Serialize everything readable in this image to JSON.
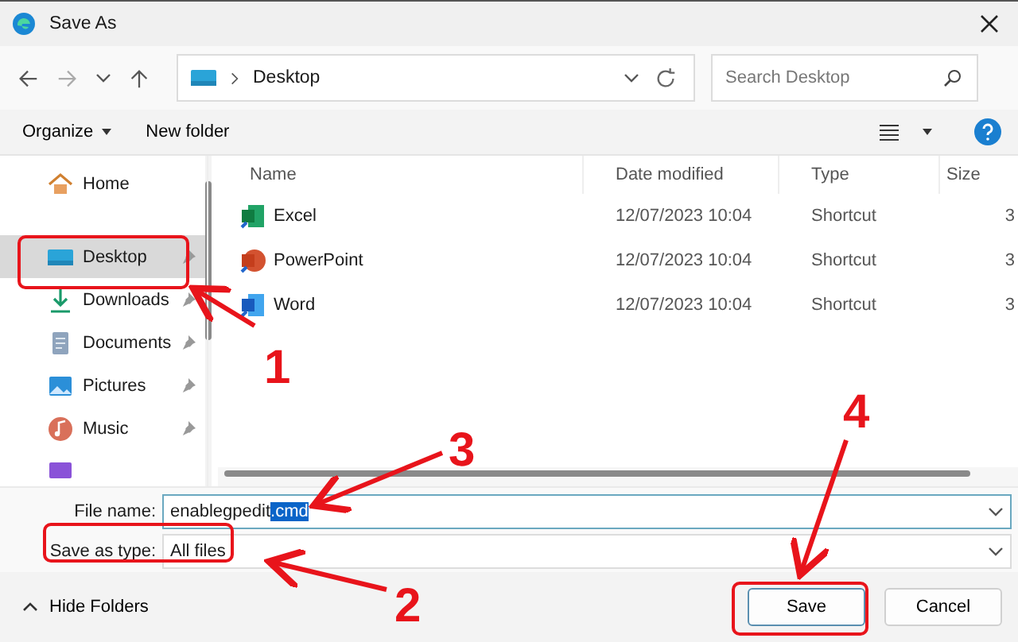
{
  "window": {
    "title": "Save As"
  },
  "address": {
    "location": "Desktop"
  },
  "search": {
    "placeholder": "Search Desktop"
  },
  "toolbar": {
    "organize": "Organize",
    "new_folder": "New folder"
  },
  "sidebar": {
    "items": [
      {
        "label": "Home",
        "kind": "home",
        "selected": false,
        "pinned": false
      },
      {
        "label": "Desktop",
        "kind": "desktop",
        "selected": true,
        "pinned": true
      },
      {
        "label": "Downloads",
        "kind": "downloads",
        "selected": false,
        "pinned": true
      },
      {
        "label": "Documents",
        "kind": "documents",
        "selected": false,
        "pinned": true
      },
      {
        "label": "Pictures",
        "kind": "pictures",
        "selected": false,
        "pinned": true
      },
      {
        "label": "Music",
        "kind": "music",
        "selected": false,
        "pinned": true
      }
    ]
  },
  "table": {
    "columns": [
      "Name",
      "Date modified",
      "Type",
      "Size"
    ],
    "rows": [
      {
        "kind": "excel",
        "name": "Excel",
        "date": "12/07/2023 10:04",
        "type": "Shortcut",
        "size": "3"
      },
      {
        "kind": "powerpoint",
        "name": "PowerPoint",
        "date": "12/07/2023 10:04",
        "type": "Shortcut",
        "size": "3"
      },
      {
        "kind": "word",
        "name": "Word",
        "date": "12/07/2023 10:04",
        "type": "Shortcut",
        "size": "3"
      }
    ]
  },
  "file_name": {
    "label": "File name:",
    "value": "enablegpedit",
    "selection": ".cmd"
  },
  "save_as_type": {
    "label": "Save as type:",
    "value": "All files"
  },
  "hide_folders": "Hide Folders",
  "buttons": [
    {
      "label": "Save",
      "default": true
    },
    {
      "label": "Cancel",
      "default": false
    }
  ],
  "annotations": [
    "1",
    "2",
    "3",
    "4"
  ]
}
